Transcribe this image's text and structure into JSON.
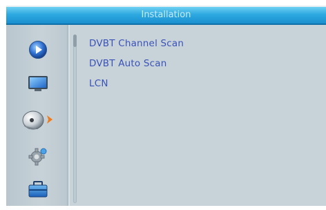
{
  "window": {
    "title": "Installation"
  },
  "sidebar": {
    "items": [
      {
        "icon": "play-circle-icon"
      },
      {
        "icon": "monitor-icon"
      },
      {
        "icon": "satellite-dish-icon",
        "selected": true
      },
      {
        "icon": "gear-icon"
      },
      {
        "icon": "toolbox-icon"
      }
    ]
  },
  "menu": {
    "items": [
      {
        "label": "DVBT Channel Scan"
      },
      {
        "label": "DVBT Auto Scan"
      },
      {
        "label": "LCN"
      }
    ]
  },
  "colors": {
    "title_bar": "#2ea9e0",
    "panel": "#c8d3d9",
    "menu_text": "#3a52b8",
    "selection_arrow": "#f07a1a"
  }
}
